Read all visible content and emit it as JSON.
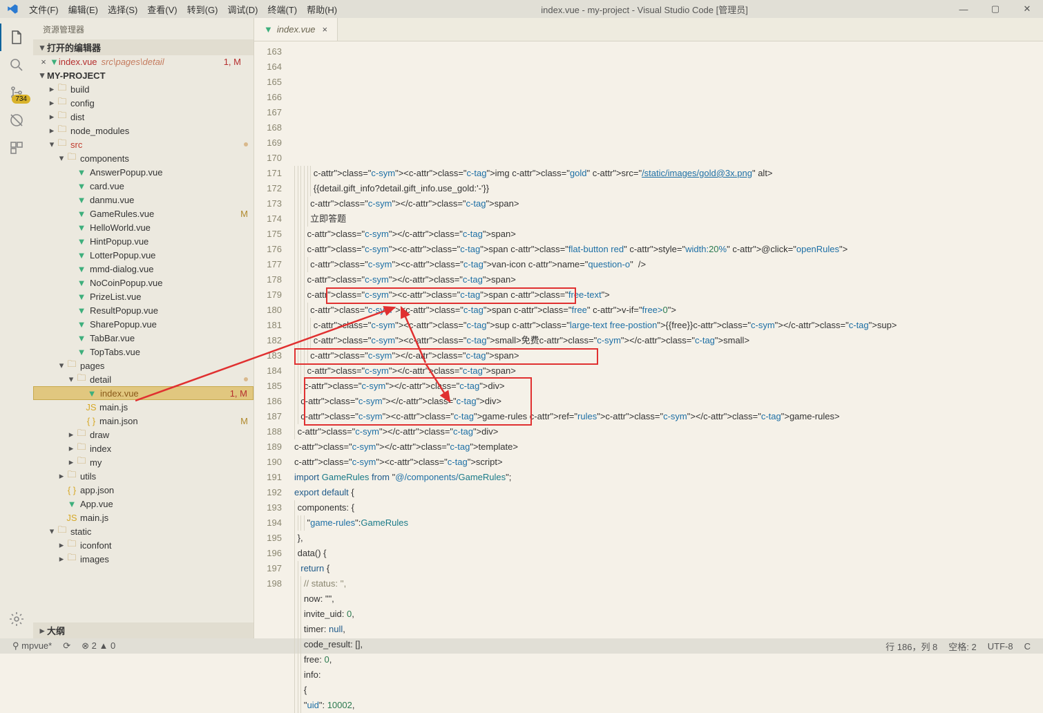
{
  "window": {
    "title": "index.vue - my-project - Visual Studio Code [管理员]"
  },
  "menu": [
    "文件(F)",
    "编辑(E)",
    "选择(S)",
    "查看(V)",
    "转到(G)",
    "调试(D)",
    "终端(T)",
    "帮助(H)"
  ],
  "activityBar": {
    "badge": "734"
  },
  "sidebar": {
    "title": "资源管理器",
    "openEditorsTitle": "打开的编辑器",
    "openEditor": {
      "name": "index.vue",
      "path": "src\\pages\\detail",
      "status": "1, M"
    },
    "projectName": "MY-PROJECT",
    "outlineTitle": "大纲",
    "tree": [
      {
        "d": 1,
        "t": "folder",
        "l": "build",
        "c": 0
      },
      {
        "d": 1,
        "t": "folder",
        "l": "config",
        "c": 0
      },
      {
        "d": 1,
        "t": "folder",
        "l": "dist",
        "c": 0
      },
      {
        "d": 1,
        "t": "folder",
        "l": "node_modules",
        "c": 0
      },
      {
        "d": 1,
        "t": "folder-open",
        "l": "src",
        "c": 1,
        "src": 1,
        "dot": 1
      },
      {
        "d": 2,
        "t": "folder-open",
        "l": "components",
        "c": 1
      },
      {
        "d": 3,
        "t": "vue",
        "l": "AnswerPopup.vue"
      },
      {
        "d": 3,
        "t": "vue",
        "l": "card.vue"
      },
      {
        "d": 3,
        "t": "vue",
        "l": "danmu.vue"
      },
      {
        "d": 3,
        "t": "vue",
        "l": "GameRules.vue",
        "tag": "M"
      },
      {
        "d": 3,
        "t": "vue",
        "l": "HelloWorld.vue"
      },
      {
        "d": 3,
        "t": "vue",
        "l": "HintPopup.vue"
      },
      {
        "d": 3,
        "t": "vue",
        "l": "LotterPopup.vue"
      },
      {
        "d": 3,
        "t": "vue",
        "l": "mmd-dialog.vue"
      },
      {
        "d": 3,
        "t": "vue",
        "l": "NoCoinPopup.vue"
      },
      {
        "d": 3,
        "t": "vue",
        "l": "PrizeList.vue"
      },
      {
        "d": 3,
        "t": "vue",
        "l": "ResultPopup.vue"
      },
      {
        "d": 3,
        "t": "vue",
        "l": "SharePopup.vue"
      },
      {
        "d": 3,
        "t": "vue",
        "l": "TabBar.vue"
      },
      {
        "d": 3,
        "t": "vue",
        "l": "TopTabs.vue"
      },
      {
        "d": 2,
        "t": "folder-open",
        "l": "pages",
        "c": 1
      },
      {
        "d": 3,
        "t": "folder-open",
        "l": "detail",
        "c": 1,
        "dot": 1
      },
      {
        "d": 4,
        "t": "vue",
        "l": "index.vue",
        "sel": 1,
        "tag2": "1, M"
      },
      {
        "d": 4,
        "t": "js",
        "l": "main.js"
      },
      {
        "d": 4,
        "t": "json",
        "l": "main.json",
        "tag": "M"
      },
      {
        "d": 3,
        "t": "folder",
        "l": "draw",
        "c": 0
      },
      {
        "d": 3,
        "t": "folder",
        "l": "index",
        "c": 0
      },
      {
        "d": 3,
        "t": "folder",
        "l": "my",
        "c": 0
      },
      {
        "d": 2,
        "t": "folder",
        "l": "utils",
        "c": 0
      },
      {
        "d": 2,
        "t": "json",
        "l": "app.json"
      },
      {
        "d": 2,
        "t": "vue",
        "l": "App.vue"
      },
      {
        "d": 2,
        "t": "js",
        "l": "main.js"
      },
      {
        "d": 1,
        "t": "folder-open",
        "l": "static",
        "c": 1
      },
      {
        "d": 2,
        "t": "folder",
        "l": "iconfont",
        "c": 0
      },
      {
        "d": 2,
        "t": "folder",
        "l": "images",
        "c": 0
      }
    ]
  },
  "tab": {
    "label": "index.vue"
  },
  "code": {
    "start": 163,
    "lines": [
      "            <img class=\"gold\" src=\"/static/images/gold@3x.png\" alt>",
      "            {{detail.gift_info?detail.gift_info.use_gold:'-'}}",
      "          </span>",
      "          立即答题",
      "        </span>",
      "        <span class=\"flat-button red\" style=\"width:20%\" @click=\"openRules\">",
      "          <van-icon name=\"question-o\"  />",
      "        </span>",
      "        <span class=\"free-text\">",
      "          <span class=\"free\" v-if=\"free>0\">",
      "            <sup class=\"large-text free-postion\">{{free}}</sup>",
      "            <small>免费</small>",
      "          </span>",
      "        </span>",
      "      </div>",
      "    </div>",
      "    <game-rules ref=\"rules\"></game-rules>",
      "  </div>",
      "</template>",
      "<script>",
      "import GameRules from \"@/components/GameRules\";",
      "export default {",
      "  components: {",
      "        \"game-rules\":GameRules",
      "  },",
      "  data() {",
      "    return {",
      "      // status: '',",
      "      now: \"\",",
      "      invite_uid: 0,",
      "      timer: null,",
      "      code_result: [],",
      "      free: 0,",
      "      info:",
      "      {",
      "      \"uid\": 10002,"
    ]
  },
  "status": {
    "left": [
      "⚲ mpvue*",
      "⟳",
      "⊗ 2 ▲ 0"
    ],
    "right": [
      "行 186，列 8",
      "空格: 2",
      "UTF-8",
      "C"
    ]
  }
}
